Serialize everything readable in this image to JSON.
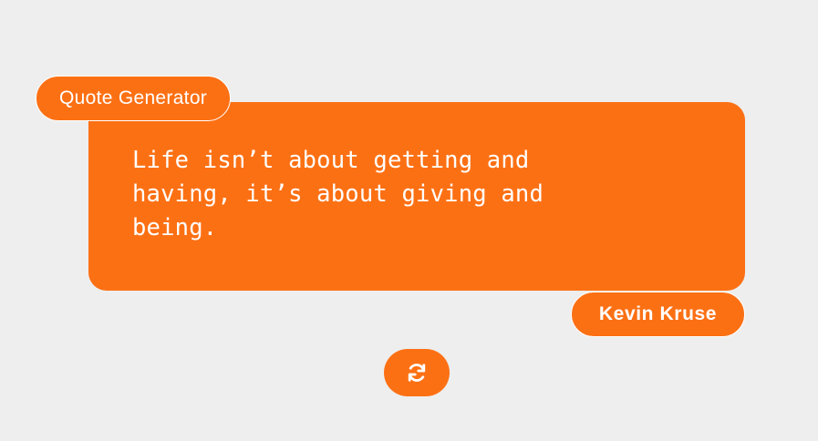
{
  "app": {
    "title": "Quote Generator"
  },
  "quote": {
    "text": "Life isn’t about getting and having, it’s about giving and being.",
    "author": "Kevin Kruse"
  },
  "controls": {
    "refresh_icon": "refresh-icon"
  },
  "colors": {
    "accent": "#fc7014",
    "background": "#eeeeee",
    "text": "#ffffff"
  }
}
